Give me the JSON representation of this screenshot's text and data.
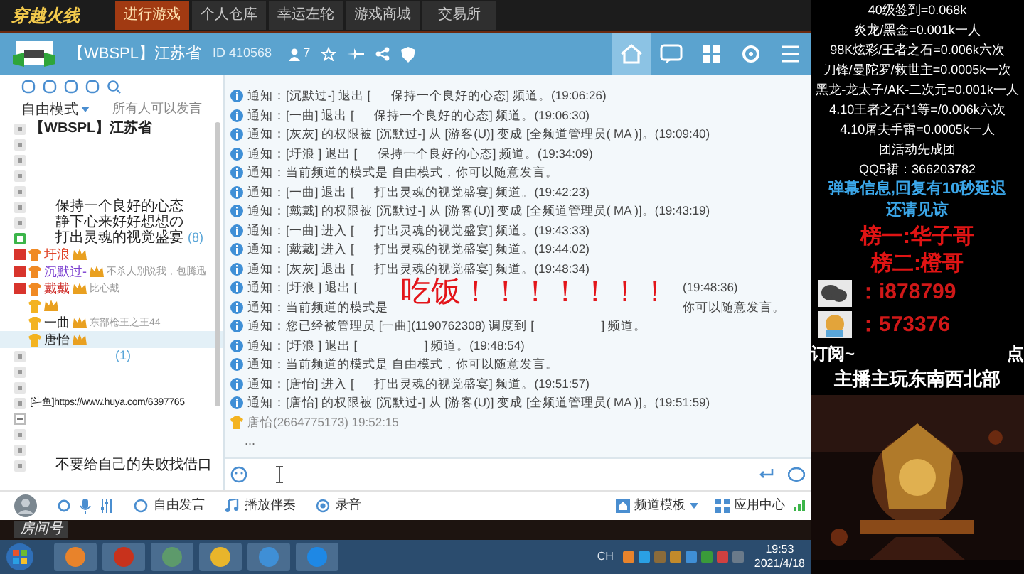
{
  "game_bar": {
    "logo": "穿越火线",
    "tabs": [
      {
        "label": "进行游戏",
        "selected": true
      },
      {
        "label": "个人仓库",
        "selected": false
      },
      {
        "label": "幸运左轮",
        "selected": false
      },
      {
        "label": "游戏商城",
        "selected": false
      },
      {
        "label": "交易所",
        "selected": false
      }
    ]
  },
  "channel_header": {
    "title": "【WBSPL】江苏省",
    "id": "ID 410568",
    "members": "7"
  },
  "left_panel": {
    "mode": "自由模式",
    "mode_note": "所有人可以发言",
    "tree": {
      "name": "【WBSPL】江苏省",
      "children": [
        {
          "kind": "blank"
        },
        {
          "kind": "blank"
        },
        {
          "kind": "blank"
        },
        {
          "kind": "blank"
        },
        {
          "kind": "channel",
          "name": "保持一个良好的心态",
          "current": false
        },
        {
          "kind": "channel",
          "name": "静下心来好好想想の",
          "current": false
        },
        {
          "kind": "channel",
          "name": "打出灵魂的视觉盛宴",
          "count": "(8)",
          "current": true,
          "children": [
            {
              "kind": "user",
              "name": "圩浪",
              "color": "#e0452a",
              "vip": true,
              "selected": false
            },
            {
              "kind": "user",
              "name": "沉默过-",
              "color": "#7b3fd0",
              "vip": true,
              "note": "不杀人别说我，包腾迅",
              "selected": false
            },
            {
              "kind": "user",
              "name": "戴戴",
              "color": "#d0312d",
              "vip": true,
              "note": "比心戴",
              "selected": false
            },
            {
              "kind": "user_unnamed",
              "selected": false
            },
            {
              "kind": "user",
              "name": "一曲",
              "color": "#222222",
              "vip": false,
              "note": "东部枪王之王44",
              "selected": false
            },
            {
              "kind": "user",
              "name": "唐怡",
              "color": "#222222",
              "vip": false,
              "selected": true
            }
          ]
        },
        {
          "kind": "channel",
          "count": "(1)",
          "current": false
        },
        {
          "kind": "blank"
        },
        {
          "kind": "blank"
        },
        {
          "kind": "channel",
          "name": "[斗鱼]https://www.huya.com/6397765",
          "current": false
        },
        {
          "kind": "minus"
        },
        {
          "kind": "blank"
        },
        {
          "kind": "blank"
        },
        {
          "kind": "channel",
          "name": "不要给自己的失败找借口",
          "current": false
        }
      ]
    }
  },
  "chat": {
    "messages": [
      {
        "kind": "notice",
        "text": "通知：[沉默过-] 退出 [      保持一个良好的心态] 频道。(19:06:26)"
      },
      {
        "kind": "notice",
        "text": "通知：[一曲] 退出 [      保持一个良好的心态] 频道。(19:06:30)"
      },
      {
        "kind": "notice",
        "text": "通知：[灰灰] 的权限被 [沉默过-] 从 [游客(U)] 变成 [全频道管理员( MA )]。(19:09:40)"
      },
      {
        "kind": "notice",
        "text": "通知：[圩浪 ] 退出 [      保持一个良好的心态] 频道。(19:34:09)"
      },
      {
        "kind": "notice",
        "text": "通知：当前频道的模式是 自由模式，你可以随意发言。"
      },
      {
        "kind": "notice",
        "text": "通知：[一曲] 退出 [      打出灵魂的视觉盛宴] 频道。(19:42:23)"
      },
      {
        "kind": "notice",
        "text": "通知：[戴戴] 的权限被 [沉默过-] 从 [游客(U)] 变成 [全频道管理员( MA )]。(19:43:19)"
      },
      {
        "kind": "notice",
        "text": "通知：[一曲] 进入 [      打出灵魂的视觉盛宴] 频道。(19:43:33)"
      },
      {
        "kind": "notice",
        "text": "通知：[戴戴] 进入 [      打出灵魂的视觉盛宴] 频道。(19:44:02)"
      },
      {
        "kind": "notice",
        "text": "通知：[灰灰] 退出 [      打出灵魂的视觉盛宴] 频道。(19:48:34)"
      },
      {
        "kind": "notice_split",
        "text": "通知：[圩浪 ] 退出 [",
        "tail": "(19:48:36)"
      },
      {
        "kind": "notice_split",
        "text": "通知：当前频道的模式是",
        "tail": "你可以随意发言。"
      },
      {
        "kind": "notice",
        "text": "通知：您已经被管理员 [一曲](1190762308) 调度到 [                    ] 频道。"
      },
      {
        "kind": "notice",
        "text": "通知：[圩浪 ] 退出 [                    ] 频道。(19:48:54)"
      },
      {
        "kind": "notice",
        "text": "通知：当前频道的模式是 自由模式，你可以随意发言。"
      },
      {
        "kind": "notice",
        "text": "通知：[唐怡] 进入 [      打出灵魂的视觉盛宴] 频道。(19:51:57)"
      },
      {
        "kind": "notice",
        "text": "通知：[唐怡] 的权限被 [沉默过-] 从 [游客(U)] 变成 [全频道管理员( MA )]。(19:51:59)"
      },
      {
        "kind": "user",
        "text": "唐怡(2664775173) 19:52:15"
      },
      {
        "kind": "body",
        "text": "..."
      }
    ],
    "overlay_text": "吃饭！！！！！！！"
  },
  "toolbar": {
    "left": [
      "自由发言",
      "播放伴奏",
      "录音"
    ],
    "template": "频道模板",
    "apps": "应用中心"
  },
  "game_strip": {
    "label": "房间号"
  },
  "taskbar": {
    "ime": "CH",
    "time": "19:53",
    "date": "2021/4/18"
  },
  "stream_panel": {
    "info_lines": [
      "40级签到=0.068k",
      "炎龙/黑金=0.001k一人",
      "98K炫彩/王者之石=0.006k六次",
      "刀锋/曼陀罗/救世主=0.0005k一次",
      "黑龙-龙太子/AK-二次元=0.001k一人",
      "4.10王者之石*1等=/0.006k六次",
      "4.10屠夫手雷=0.0005k一人",
      "团活动先成团",
      "QQ5裙：366203782"
    ],
    "notice_lines": [
      "弹幕信息,回复有10秒延迟",
      "还请见谅"
    ],
    "ranks": [
      "榜一:华子哥",
      "榜二:橙哥"
    ],
    "contacts": [
      {
        "kind": "wechat",
        "text": "：i878799"
      },
      {
        "kind": "mascot",
        "text": "：573376"
      }
    ],
    "subscribe": "订阅~",
    "subscribe_right": "点",
    "streamer_note": "主播主玩东南西北部"
  }
}
